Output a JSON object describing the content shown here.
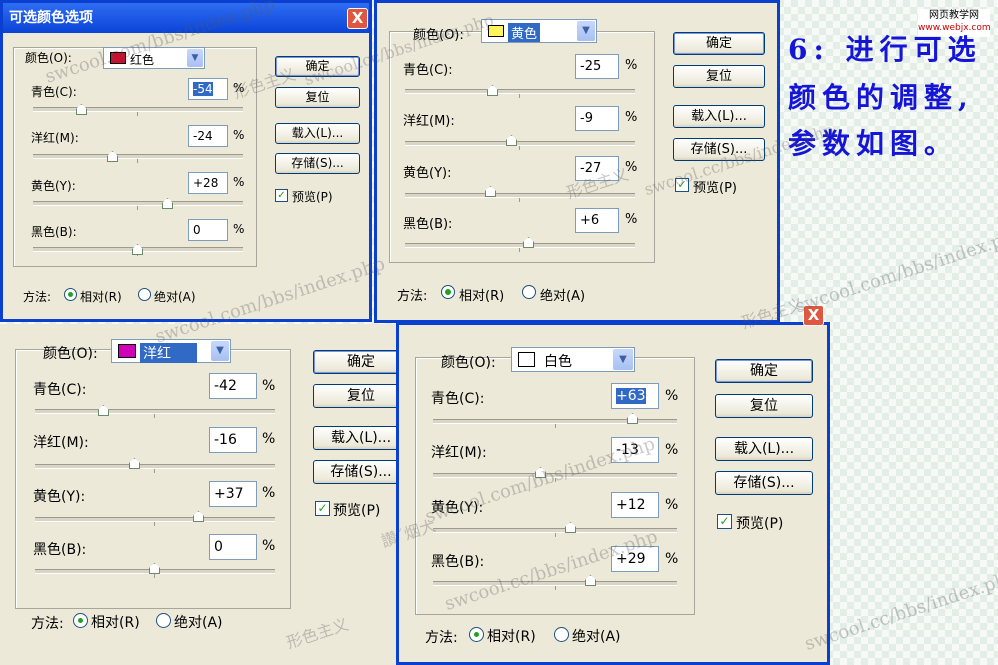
{
  "logo": {
    "line1": "网页教学网",
    "line2": "www.webjx.com"
  },
  "note": {
    "line1": "6: 进行可选",
    "line2": "颜色的调整,",
    "line3": "参数如图。"
  },
  "watermarks": [
    "swcool.com/bbs/index.php",
    "swcool.cc/bbs/index.php",
    "形色主义",
    "讚ˇ烟大"
  ],
  "labels": {
    "color": "颜色(O):",
    "cyan": "青色(C):",
    "magenta": "洋红(M):",
    "yellow": "黄色(Y):",
    "black": "黑色(B):",
    "method": "方法:",
    "relative": "相对(R)",
    "absolute": "绝对(A)",
    "percent": "%",
    "ok": "确定",
    "reset": "复位",
    "load": "载入(L)...",
    "save": "存储(S)...",
    "preview": "预览(P)",
    "check": "✓"
  },
  "dialogs": {
    "d1": {
      "title": "可选颜色选项",
      "close": "X",
      "color_name": "红色",
      "swatch": "#c8102e",
      "cyan": "-54",
      "magenta": "-24",
      "yellow": "+28",
      "black": "0"
    },
    "d2": {
      "color_name": "黄色",
      "swatch": "#fff45a",
      "cyan": "-25",
      "magenta": "-9",
      "yellow": "-27",
      "black": "+6"
    },
    "d3": {
      "color_name": "洋红",
      "swatch": "#d100b8",
      "cyan": "-42",
      "magenta": "-16",
      "yellow": "+37",
      "black": "0"
    },
    "d4": {
      "close": "X",
      "color_name": "白色",
      "swatch": "#ffffff",
      "cyan": "+63",
      "magenta": "-13",
      "yellow": "+12",
      "black": "+29"
    }
  }
}
